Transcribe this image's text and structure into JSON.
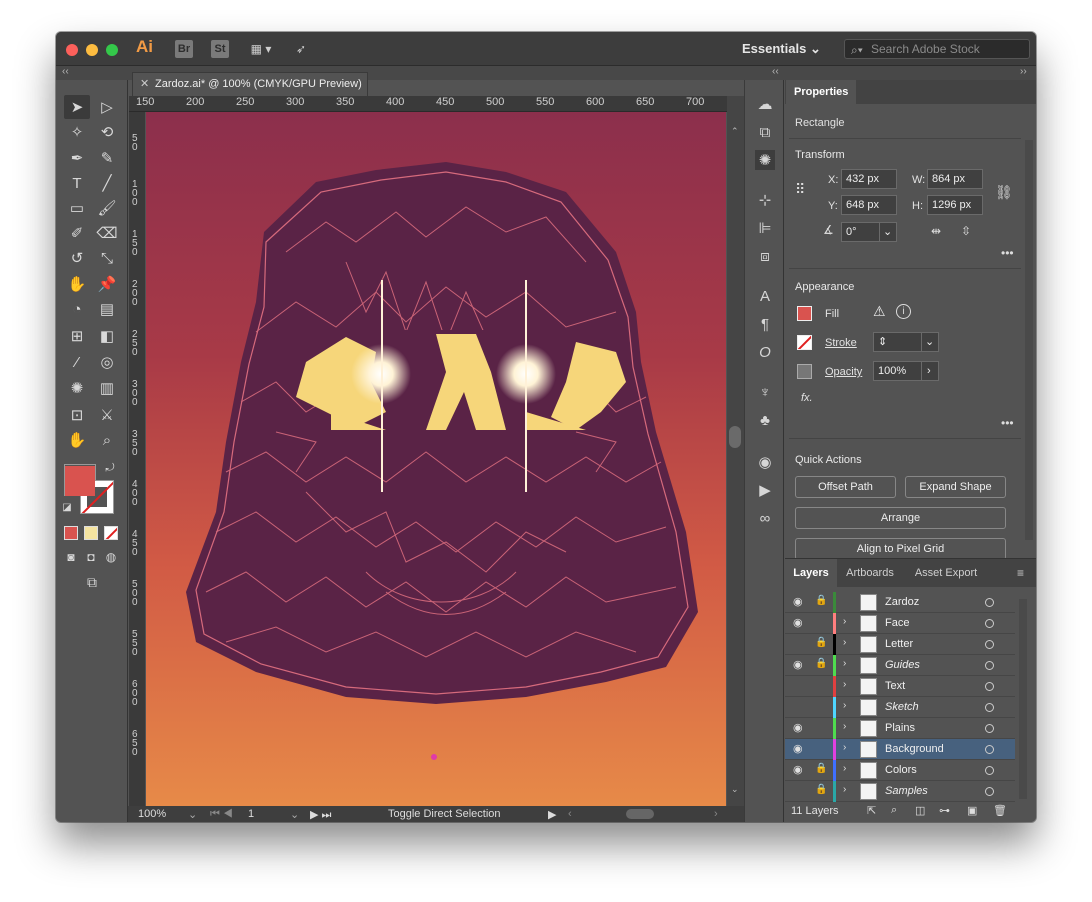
{
  "titlebar": {
    "app_logo": "Ai",
    "bridge": "Br",
    "stock_app": "St",
    "workspace": "Essentials",
    "search_placeholder": "Search Adobe Stock"
  },
  "document": {
    "tab_title": "Zardoz.ai* @ 100% (CMYK/GPU Preview)",
    "ruler_h": [
      "150",
      "200",
      "250",
      "300",
      "350",
      "400",
      "450",
      "500",
      "550",
      "600",
      "650",
      "700"
    ],
    "ruler_v": [
      "50",
      "100",
      "150",
      "200",
      "250",
      "300",
      "350",
      "400",
      "450",
      "500",
      "550",
      "600",
      "650"
    ]
  },
  "statusbar": {
    "zoom": "100%",
    "artboard": "1",
    "tool_hint": "Toggle Direct Selection"
  },
  "properties": {
    "tab": "Properties",
    "selection": "Rectangle",
    "transform": {
      "title": "Transform",
      "x_label": "X:",
      "x": "432 px",
      "y_label": "Y:",
      "y": "648 px",
      "w_label": "W:",
      "w": "864 px",
      "h_label": "H:",
      "h": "1296 px",
      "angle": "0°"
    },
    "appearance": {
      "title": "Appearance",
      "fill": "Fill",
      "stroke": "Stroke",
      "opacity_label": "Opacity",
      "opacity": "100%",
      "fx": "fx."
    },
    "quick_actions": {
      "title": "Quick Actions",
      "offset_path": "Offset Path",
      "expand_shape": "Expand Shape",
      "arrange": "Arrange",
      "align": "Align to Pixel Grid"
    }
  },
  "layers_panel": {
    "tabs": [
      "Layers",
      "Artboards",
      "Asset Export"
    ],
    "layers": [
      {
        "name": "Zardoz",
        "color": "#3a8a3a",
        "eye": true,
        "lock": true
      },
      {
        "name": "Face",
        "color": "#ff7f7f",
        "eye": true,
        "lock": false
      },
      {
        "name": "Letter",
        "color": "#000000",
        "eye": false,
        "lock": true
      },
      {
        "name": "Guides",
        "color": "#4fdc4f",
        "eye": true,
        "lock": true
      },
      {
        "name": "Text",
        "color": "#e04040",
        "eye": false,
        "lock": false
      },
      {
        "name": "Sketch",
        "color": "#4fd6ff",
        "eye": false,
        "lock": false
      },
      {
        "name": "Plains",
        "color": "#4fdc4f",
        "eye": true,
        "lock": false
      },
      {
        "name": "Background",
        "color": "#e040e0",
        "eye": true,
        "lock": false
      },
      {
        "name": "Colors",
        "color": "#3f6fff",
        "eye": true,
        "lock": true
      },
      {
        "name": "Samples",
        "color": "#2aa8a8",
        "eye": false,
        "lock": true
      }
    ],
    "count": "11 Layers"
  },
  "colors": {
    "fill_swatch": "#d9534f",
    "selected_layer_bg": "#47617e"
  }
}
